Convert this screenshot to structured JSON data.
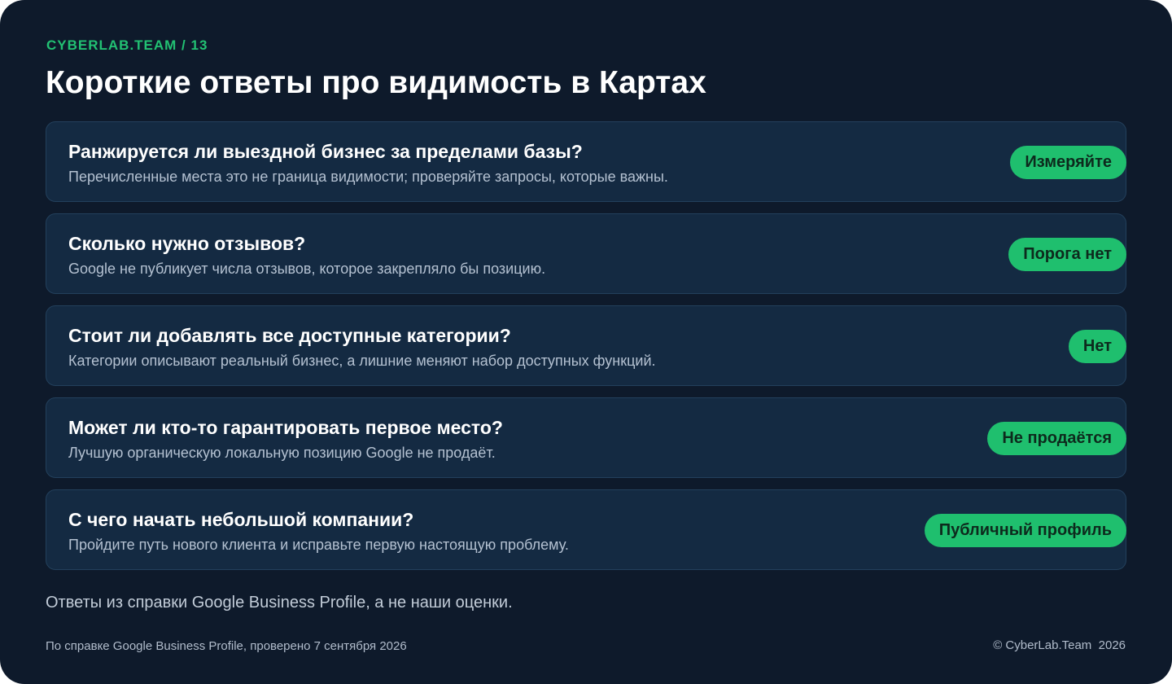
{
  "header": {
    "eyebrow": "CYBERLAB.TEAM / 13",
    "title": "Короткие ответы про видимость в Картах"
  },
  "cards": [
    {
      "question": "Ранжируется ли выездной бизнес за пределами базы?",
      "answer": "Перечисленные места это не граница видимости; проверяйте запросы, которые важны.",
      "badge": "Измеряйте"
    },
    {
      "question": "Сколько нужно отзывов?",
      "answer": "Google не публикует числа отзывов, которое закрепляло бы позицию.",
      "badge": "Порога нет"
    },
    {
      "question": "Стоит ли добавлять все доступные категории?",
      "answer": "Категории описывают реальный бизнес, а лишние меняют набор доступных функций.",
      "badge": "Нет"
    },
    {
      "question": "Может ли кто-то гарантировать первое место?",
      "answer": "Лучшую органическую локальную позицию Google не продаёт.",
      "badge": "Не продаётся"
    },
    {
      "question": "С чего начать небольшой компании?",
      "answer": "Пройдите путь нового клиента и исправьте первую настоящую проблему.",
      "badge": "Публичный профиль"
    }
  ],
  "note": "Ответы из справки Google Business Profile, а не наши оценки.",
  "footer": {
    "source": "По справке Google Business Profile, проверено 7 сентября 2026",
    "copyright": "© CyberLab.Team  2026"
  },
  "colors": {
    "background": "#0e1a2b",
    "card": "#142a42",
    "accent": "#1fbf6e",
    "eyebrow": "#22c173"
  }
}
